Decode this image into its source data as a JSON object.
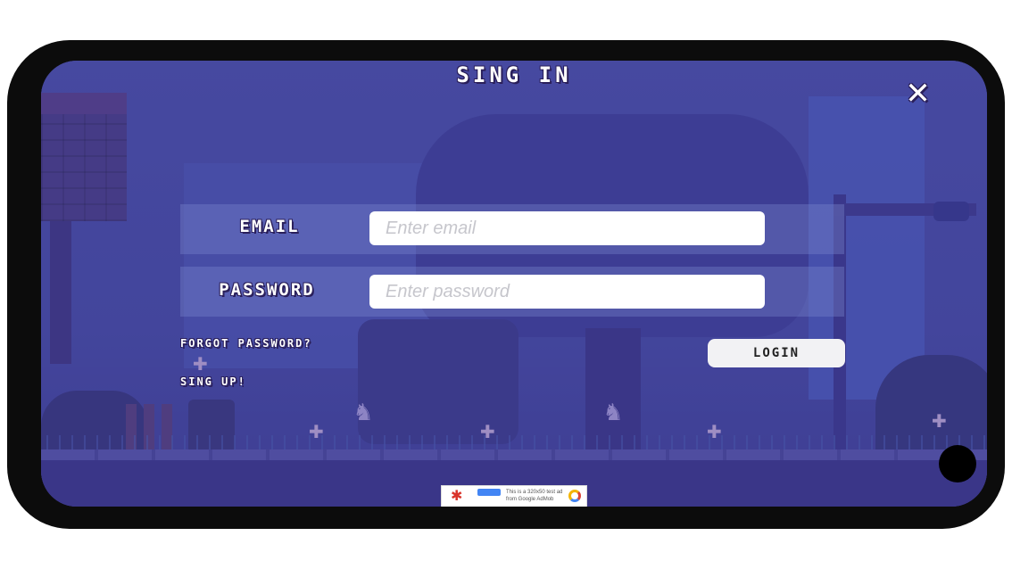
{
  "title": "SING IN",
  "close_icon": "close-x-icon",
  "email": {
    "label": "EMAIL",
    "placeholder": "Enter email",
    "value": ""
  },
  "password": {
    "label": "PASSWORD",
    "placeholder": "Enter password",
    "value": ""
  },
  "links": {
    "forgot_password": "FORGOT PASSWORD?",
    "sign_up": "SING UP!"
  },
  "login_button": "LOGIN",
  "ad": {
    "text": "This is a 320x50 test ad from Google AdMob",
    "logo_icon": "admob-logo-icon"
  },
  "colors": {
    "screen_bg": "#4b4a9a",
    "button_bg": "#f2f2f4",
    "text_shadow": "#2a1f5a"
  }
}
